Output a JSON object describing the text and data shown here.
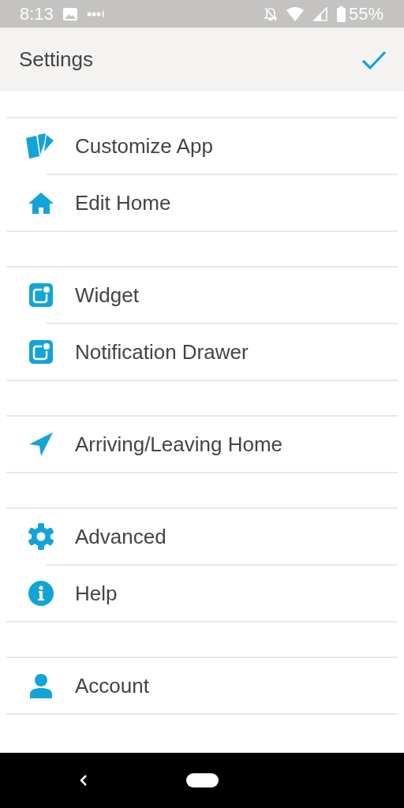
{
  "status_bar": {
    "time": "8:13",
    "battery": "55%"
  },
  "app_bar": {
    "title": "Settings"
  },
  "groups": [
    {
      "items": [
        {
          "label": "Customize App",
          "kind": "cards"
        },
        {
          "label": "Edit Home",
          "kind": "home"
        }
      ]
    },
    {
      "items": [
        {
          "label": "Widget",
          "kind": "widget"
        },
        {
          "label": "Notification Drawer",
          "kind": "widget"
        }
      ]
    },
    {
      "items": [
        {
          "label": "Arriving/Leaving Home",
          "kind": "arrow"
        }
      ]
    },
    {
      "items": [
        {
          "label": "Advanced",
          "kind": "gear"
        },
        {
          "label": "Help",
          "kind": "info"
        }
      ]
    },
    {
      "items": [
        {
          "label": "Account",
          "kind": "person"
        }
      ]
    }
  ]
}
